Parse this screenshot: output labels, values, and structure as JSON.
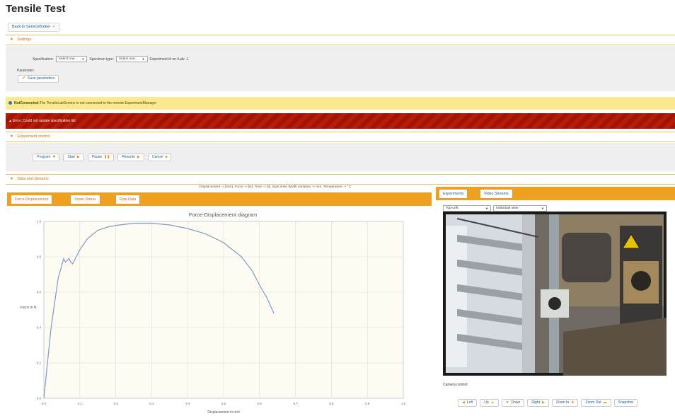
{
  "page": {
    "title": "Tensile Test"
  },
  "nav": {
    "back_label": "Back to ServiceBroker"
  },
  "settings": {
    "header": "Settings",
    "specification_label": "Specification:",
    "specification_value": "Select one...",
    "specimen_label": "Specimen type:",
    "specimen_value": "Select one...",
    "experiment_text": "Experiment id on iLab: -1",
    "parameter_label": "Parameter:",
    "save_label": "Save parameters"
  },
  "alerts": {
    "warning_strong": "NotConnected:",
    "warning_text": "The TensileLabService is not connected to the remote ExperimentManager",
    "error_text": "Error: Could not update specification list"
  },
  "control": {
    "header": "Experiment control",
    "buttons": [
      "Program",
      "Start",
      "Pause",
      "Resume",
      "Cancel"
    ]
  },
  "data_streams": {
    "header": "Data and Streams",
    "units_line": "Displacement -> [mm], Force -> [N], Time -> [s], Specimen Width variation -> mm, Temperature -> °C",
    "tabs": [
      "Force-Displacement",
      "Strain-Stress",
      "Raw Data"
    ]
  },
  "right_panel": {
    "tabs": [
      "Experiments",
      "Video Streams"
    ],
    "camera_select": "Top-Left",
    "mode_select": "Individual view",
    "camera_control_label": "Camera control:",
    "camera_buttons": [
      "Left",
      "Up",
      "Down",
      "Right",
      "Zoom In",
      "Zoom Out",
      "Snapshot"
    ]
  },
  "chart_data": {
    "type": "line",
    "title": "Force-Displacement diagram",
    "xlabel": "Displacement in mm",
    "ylabel": "Force in N",
    "xlim": [
      0.0,
      1.0
    ],
    "ylim": [
      0.0,
      1.0
    ],
    "x_ticks": [
      "0.0",
      "0.1",
      "0.2",
      "0.3",
      "0.4",
      "0.5",
      "0.6",
      "0.7",
      "0.8",
      "0.9",
      "1.0"
    ],
    "y_ticks": [
      "0.0",
      "0.2",
      "0.4",
      "0.6",
      "0.8",
      "1.0"
    ],
    "grid": true,
    "series": [
      {
        "color": "#7a9cc6",
        "x": [
          0.0,
          0.02,
          0.04,
          0.055,
          0.06,
          0.065,
          0.07,
          0.075,
          0.08,
          0.085,
          0.09,
          0.1,
          0.12,
          0.15,
          0.18,
          0.21,
          0.25,
          0.3,
          0.35,
          0.4,
          0.45,
          0.5,
          0.55,
          0.58,
          0.6,
          0.62,
          0.64
        ],
        "y": [
          0.0,
          0.4,
          0.68,
          0.79,
          0.77,
          0.78,
          0.79,
          0.77,
          0.76,
          0.78,
          0.8,
          0.84,
          0.9,
          0.95,
          0.97,
          0.98,
          0.99,
          0.99,
          0.98,
          0.96,
          0.93,
          0.88,
          0.8,
          0.72,
          0.64,
          0.57,
          0.48
        ]
      }
    ]
  }
}
